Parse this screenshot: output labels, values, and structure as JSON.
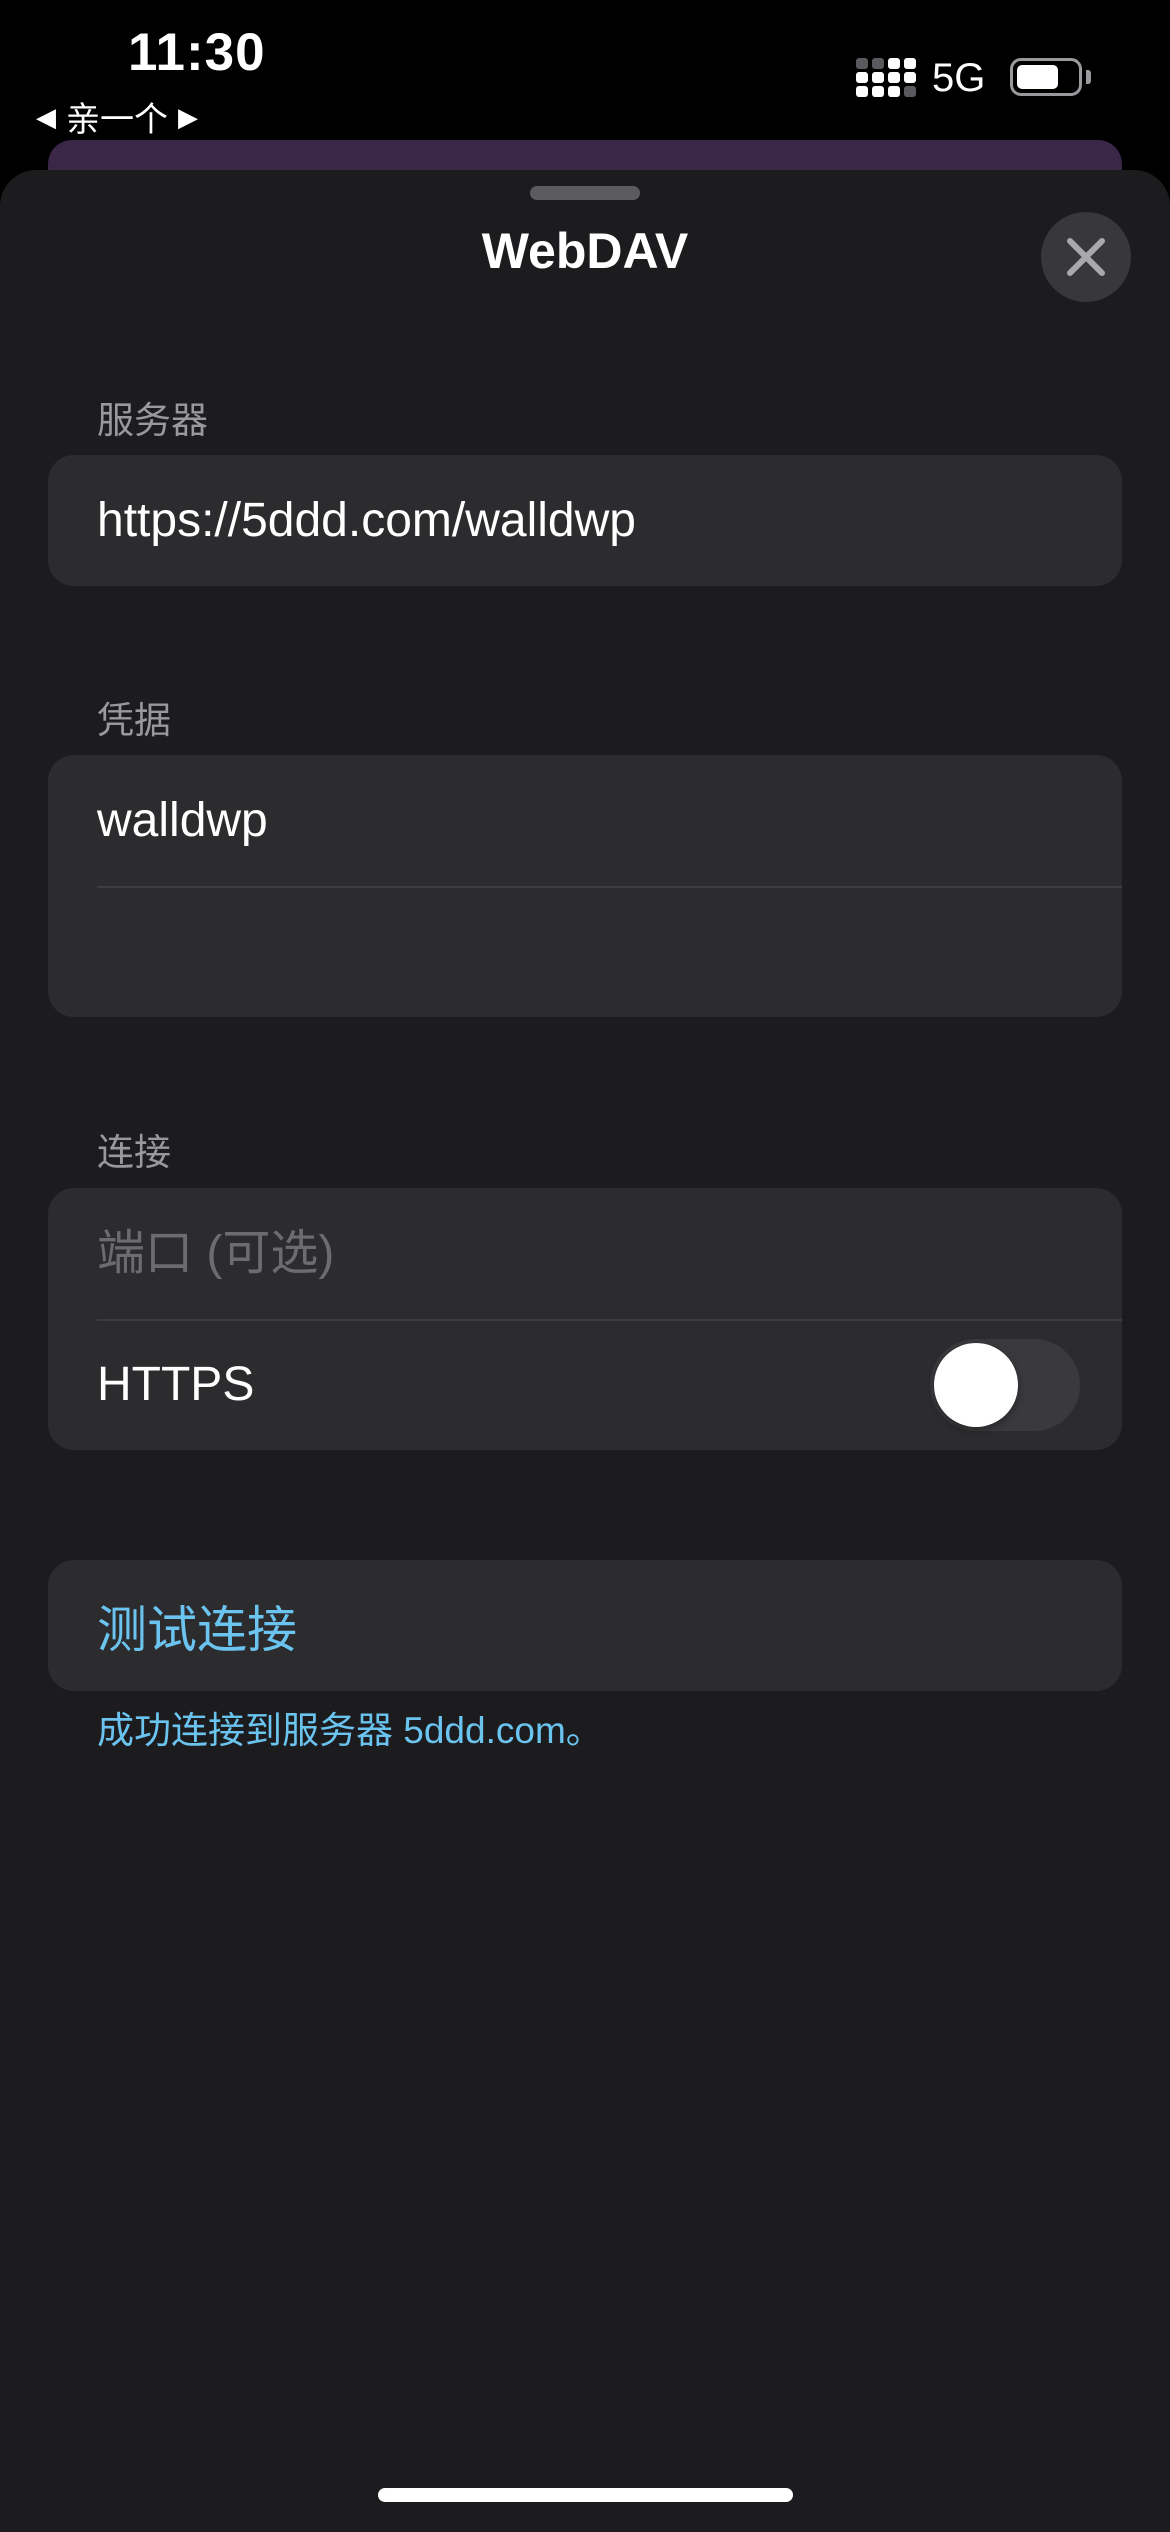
{
  "status_bar": {
    "time": "11:30",
    "back_app": "亲一个",
    "network": "5G",
    "battery_level": 0.7
  },
  "sheet": {
    "title": "WebDAV"
  },
  "server": {
    "section_label": "服务器",
    "url": "https://5ddd.com/walldwp"
  },
  "credentials": {
    "section_label": "凭据",
    "username": "walldwp",
    "password": ""
  },
  "connection": {
    "section_label": "连接",
    "port_placeholder": "端口 (可选)",
    "port_value": "",
    "https_label": "HTTPS",
    "https_enabled": false
  },
  "test": {
    "button_label": "测试连接",
    "result_message": "成功连接到服务器 5ddd.com。"
  },
  "colors": {
    "sheet_background": "#1c1c1e",
    "group_background": "#2c2c2e",
    "accent": "#6ac4ef",
    "secondary_text": "#98989e"
  },
  "icons": {
    "close": "close-icon",
    "signal": "cellular-signal-icon",
    "battery": "battery-icon",
    "back": "back-triangle-icon"
  }
}
